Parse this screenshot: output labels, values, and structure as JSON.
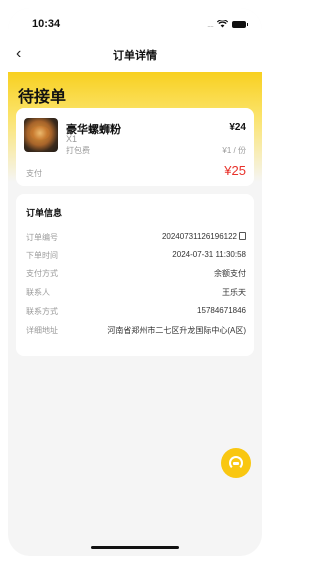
{
  "status_bar": {
    "time": "10:34",
    "signal": "....",
    "icons": [
      "wifi-icon",
      "battery-icon"
    ]
  },
  "nav": {
    "back_icon": "‹",
    "title": "订单详情"
  },
  "order_status": "待接单",
  "goods": {
    "name": "豪华螺蛳粉",
    "qty": "X1",
    "price": "¥24",
    "pack_label": "打包费",
    "pack_value": "¥1 / 份",
    "pay_label": "支付",
    "pay_value": "¥25"
  },
  "info": {
    "title": "订单信息",
    "rows": [
      {
        "label": "订单编号",
        "value": "20240731126196122"
      },
      {
        "label": "下单时间",
        "value": "2024-07-31 11:30:58"
      },
      {
        "label": "支付方式",
        "value": "余额支付"
      },
      {
        "label": "联系人",
        "value": "王乐天"
      },
      {
        "label": "联系方式",
        "value": "15784671846"
      },
      {
        "label": "详细地址",
        "value": "河南省郑州市二七区升龙国际中心(A区)"
      }
    ]
  },
  "colors": {
    "brand_yellow": "#f8d020",
    "price_red": "#e8312a"
  }
}
